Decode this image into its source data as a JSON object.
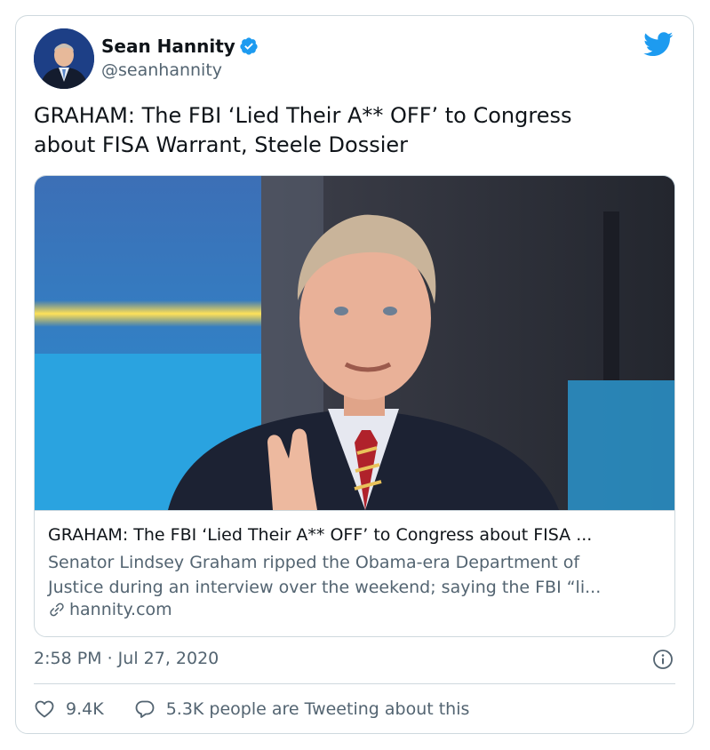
{
  "author": {
    "name": "Sean Hannity",
    "handle": "@seanhannity",
    "verified": true,
    "avatar_icon": "avatar-photo"
  },
  "tweet": {
    "text_line1": "GRAHAM: The FBI ‘Lied Their A** OFF’ to Congress",
    "text_line2": "about FISA Warrant, Steele Dossier"
  },
  "card": {
    "image_icon": "news-photo",
    "title": "GRAHAM: The FBI ‘Lied Their A** OFF’ to Congress about FISA ...",
    "description_line1": "Senator Lindsey Graham ripped the Obama-era Department of",
    "description_line2": "Justice during an interview over the weekend; saying the FBI “li...",
    "domain": "hannity.com",
    "domain_icon": "link-icon"
  },
  "meta": {
    "timestamp": "2:58 PM · Jul 27, 2020"
  },
  "actions": {
    "likes": "9.4K",
    "replies_text": "5.3K people are Tweeting about this"
  },
  "colors": {
    "twitter_blue": "#1d9bf0",
    "text_primary": "#0f1419",
    "text_secondary": "#536471",
    "border": "#cfd9de"
  }
}
